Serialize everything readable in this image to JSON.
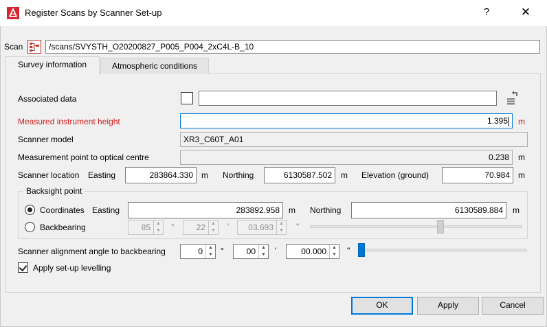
{
  "window": {
    "title": "Register Scans by Scanner Set-up",
    "help_label": "?",
    "close_label": "✕",
    "app_icon": "app-logo-icon"
  },
  "scan": {
    "label": "Scan",
    "icon": "scan-tree-icon",
    "value": "/scans/SVYSTH_O20200827_P005_P004_2xC4L-B_10"
  },
  "tabs": [
    {
      "label": "Survey information",
      "active": true
    },
    {
      "label": "Atmospheric conditions",
      "active": false
    }
  ],
  "associated_data": {
    "label": "Associated data",
    "checked": false,
    "value": "",
    "icon": "reset-icon"
  },
  "instrument_height": {
    "label": "Measured instrument height",
    "value": "1.395",
    "unit": "m",
    "label_color": "#d31f1f"
  },
  "scanner_model": {
    "label": "Scanner model",
    "value": "XR3_C60T_A01"
  },
  "optical_centre": {
    "label": "Measurement point to optical centre",
    "value": "0.238",
    "unit": "m"
  },
  "scanner_location": {
    "label": "Scanner location",
    "easting_label": "Easting",
    "easting": "283864.330",
    "easting_unit": "m",
    "northing_label": "Northing",
    "northing": "6130587.502",
    "northing_unit": "m",
    "elevation_label": "Elevation (ground)",
    "elevation": "70.984",
    "elevation_unit": "m"
  },
  "backsight": {
    "group_label": "Backsight point",
    "coordinates_label": "Coordinates",
    "coordinates_selected": true,
    "easting_label": "Easting",
    "easting": "283892.958",
    "easting_unit": "m",
    "northing_label": "Northing",
    "northing": "6130589.884",
    "northing_unit": "m",
    "backbearing_label": "Backbearing",
    "backbearing_selected": false,
    "deg": "85",
    "deg_unit": "°",
    "min": "22",
    "min_unit": "'",
    "sec": "03.693",
    "sec_unit": "\"",
    "slider_fraction": 0.62
  },
  "alignment": {
    "label": "Scanner alignment angle to backbearing",
    "deg": "0",
    "deg_unit": "°",
    "min": "00",
    "min_unit": "'",
    "sec": "00.000",
    "sec_unit": "\"",
    "slider_fraction": 0.0
  },
  "levelling": {
    "label": "Apply set-up levelling",
    "checked": true
  },
  "buttons": {
    "ok": "OK",
    "apply": "Apply",
    "cancel": "Cancel"
  },
  "colors": {
    "accent": "#0078d7",
    "warning_text": "#d31f1f",
    "logo": "#d9232d"
  }
}
